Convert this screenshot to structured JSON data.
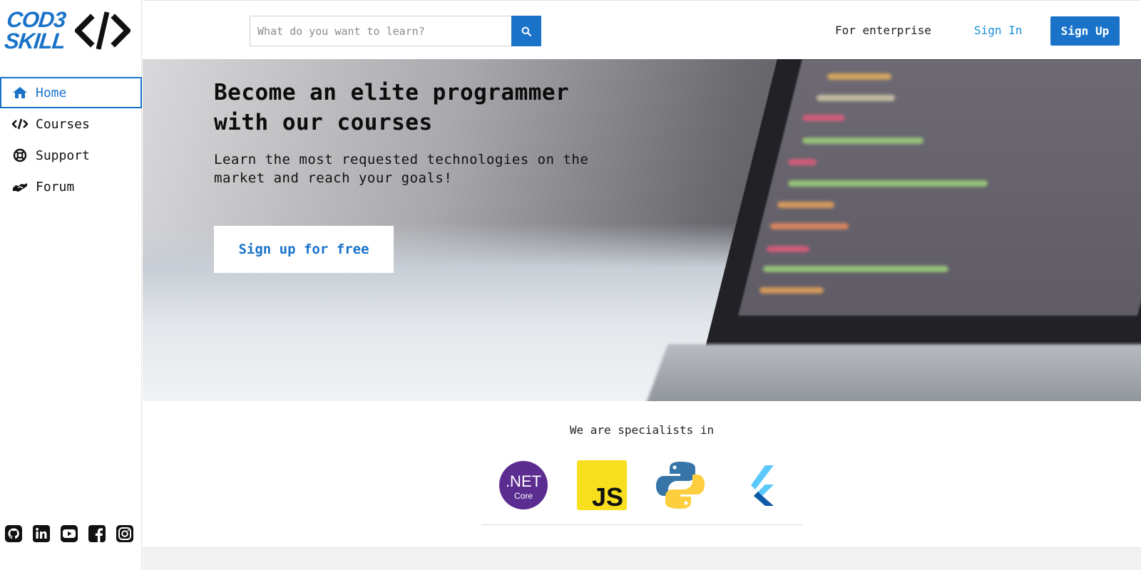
{
  "brand": {
    "line1": "COD3",
    "line2": "SKILL"
  },
  "search": {
    "placeholder": "What do you want to learn?"
  },
  "header": {
    "enterprise": "For enterprise",
    "signin": "Sign In",
    "signup": "Sign Up"
  },
  "sidebar": {
    "items": [
      {
        "label": "Home",
        "icon": "home-icon",
        "active": true
      },
      {
        "label": "Courses",
        "icon": "code-icon",
        "active": false
      },
      {
        "label": "Support",
        "icon": "life-ring-icon",
        "active": false
      },
      {
        "label": "Forum",
        "icon": "handshake-icon",
        "active": false
      }
    ],
    "social": [
      "github-icon",
      "linkedin-icon",
      "youtube-icon",
      "facebook-icon",
      "instagram-icon"
    ]
  },
  "hero": {
    "title_line1": "Become an elite programmer",
    "title_line2": "with our courses",
    "subtitle": "Learn the most requested technologies on the market and reach your goals!",
    "cta": "Sign up for free"
  },
  "specialists": {
    "title": "We are specialists in",
    "dotnet_main": ".NET",
    "dotnet_sub": "Core",
    "js": "JS",
    "tech": [
      "dotnet-core-logo",
      "javascript-logo",
      "python-logo",
      "flutter-logo"
    ]
  },
  "colors": {
    "accent": "#1a73c9",
    "link": "#1a8fd8"
  }
}
